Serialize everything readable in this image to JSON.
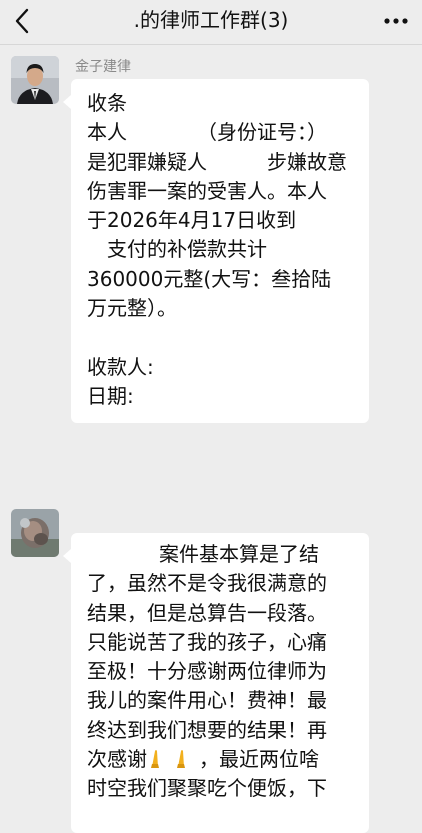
{
  "header": {
    "back_icon": "chevron-left-icon",
    "title": ".的律师工作群(3)",
    "more_icon": "more-dots-icon"
  },
  "messages": [
    {
      "sender": "金子建律",
      "avatar": "avatar-man-suit",
      "lines": [
        "收条",
        "本人　　　　（身份证号：）",
        "是犯罪嫌疑人　　　步嫌故意",
        "伤害罪一案的受害人。本人",
        "于2026年4月17日收到",
        "　支付的补偿款共计",
        "360000元整(大写：叁拾陆",
        "万元整）。",
        "",
        "收款人:",
        "日期:"
      ]
    },
    {
      "sender": "",
      "avatar": "avatar-photo-blurred",
      "lines": [
        "案件基本算是了结",
        "了，虽然不是令我很满意的",
        "结果，但是总算告一段落。",
        "只能说苦了我的孩子，心痛",
        "至极！十分感谢两位律师为",
        "我儿的案件用心！费神！最",
        "终达到我们想要的结果！再",
        "次感谢",
        "，最近两位啥",
        "时空我们聚聚吃个便饭，下"
      ],
      "emoji": "praying-hands-icon"
    }
  ],
  "colors": {
    "background": "#ededed",
    "bubble": "#ffffff",
    "sender_text": "#8a8a8a",
    "emoji": "#f2b01e"
  }
}
